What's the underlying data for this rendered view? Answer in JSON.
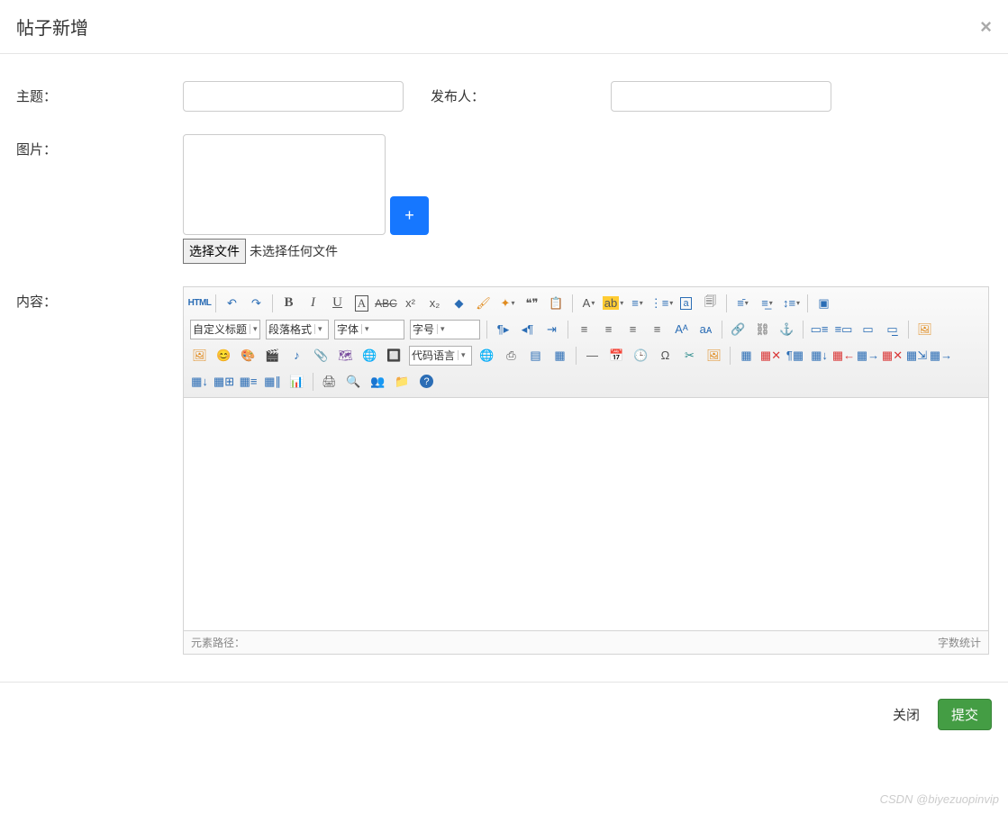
{
  "header": {
    "title": "帖子新增",
    "close": "×"
  },
  "form": {
    "subject_label": "主题：",
    "publisher_label": "发布人：",
    "image_label": "图片：",
    "content_label": "内容：",
    "plus": "+",
    "file_button": "选择文件",
    "file_status": "未选择任何文件"
  },
  "editor": {
    "html": "HTML",
    "custom_title": "自定义标题",
    "para_format": "段落格式",
    "font": "字体",
    "font_size": "字号",
    "code_lang": "代码语言",
    "path_label": "元素路径：",
    "wordcount": "字数统计",
    "glyphs": {
      "bold": "B",
      "italic": "I",
      "underline": "U",
      "boxA": "A",
      "strike": "ABC",
      "sup": "x²",
      "sub": "x₂",
      "fontA": "A",
      "quote": "❝❞",
      "ltr": "¶▸",
      "rtl": "◂¶",
      "hr": "—",
      "omega": "Ω",
      "help": "?"
    }
  },
  "footer": {
    "cancel": "关闭",
    "submit": "提交"
  },
  "watermark": "CSDN @biyezuopinvip"
}
